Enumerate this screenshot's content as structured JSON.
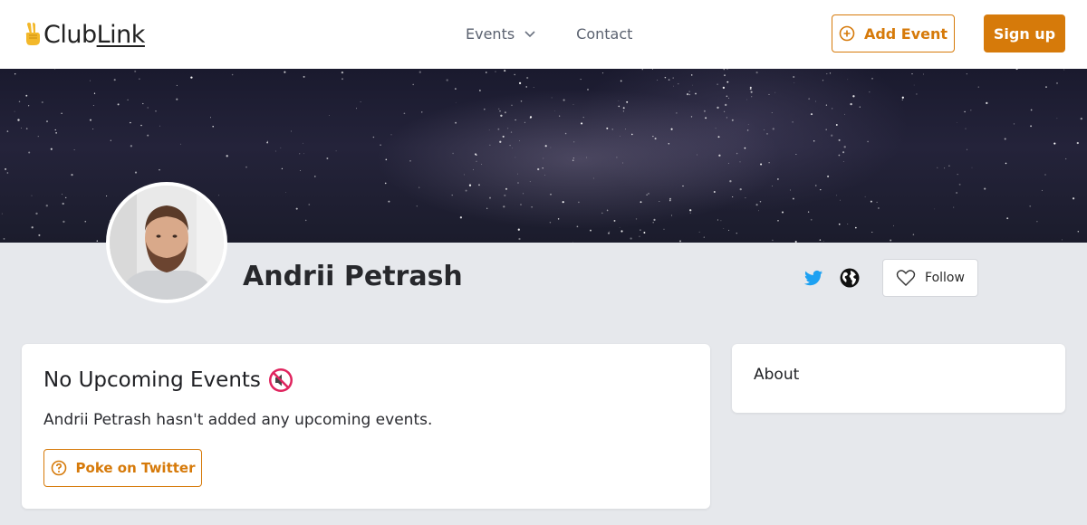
{
  "header": {
    "logo_text_club": "Club",
    "logo_text_link": "Link",
    "nav": [
      {
        "label": "Events"
      },
      {
        "label": "Contact"
      }
    ],
    "add_event_label": "Add Event",
    "signup_label": "Sign up"
  },
  "profile": {
    "name": "Andrii Petrash",
    "follow_label": "Follow"
  },
  "events_card": {
    "title": "No Upcoming Events",
    "message": "Andrii Petrash hasn't added any upcoming events.",
    "poke_label": "Poke on Twitter"
  },
  "about_card": {
    "title": "About"
  },
  "colors": {
    "accent": "#d67a0a",
    "twitter": "#1da1f2",
    "background": "#e6e8ec"
  },
  "icons": [
    "victory-hand-icon",
    "chevron-down-icon",
    "plus-circle-icon",
    "twitter-icon",
    "globe-icon",
    "heart-icon",
    "muted-speaker-icon",
    "question-circle-icon"
  ]
}
